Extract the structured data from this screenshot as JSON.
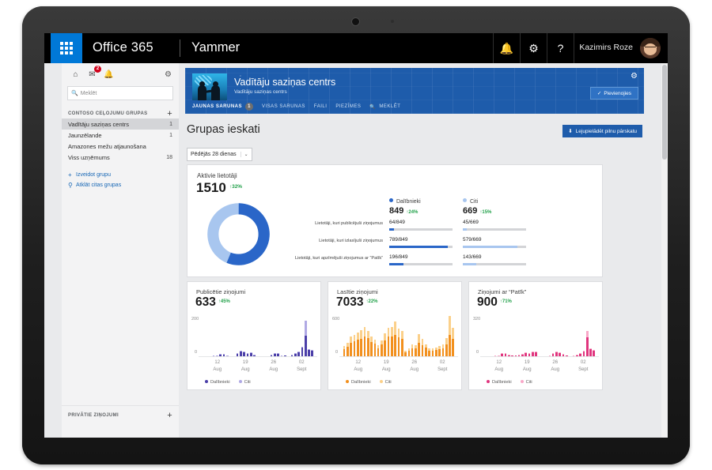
{
  "suite_bar": {
    "waffle_icon": "app-launcher-icon",
    "brand": "Office 365",
    "app": "Yammer",
    "bell_icon": "🔔",
    "gear_icon": "⚙",
    "help_icon": "?",
    "user_name": "Kazimirs Roze"
  },
  "sidebar": {
    "home_icon": "⌂",
    "inbox_icon": "✉",
    "bell_icon": "🔔",
    "inbox_badge": "2",
    "gear_icon": "⚙",
    "search_placeholder": "Meklēt",
    "search_value": "",
    "group_header": "CONTOSO CEļOJUMU GRUPAS",
    "add_icon": "+",
    "groups": [
      {
        "label": "Vadītāju saziņas centrs",
        "count": "1",
        "active": true
      },
      {
        "label": "Jaunzēlande",
        "count": "1",
        "active": false
      },
      {
        "label": "Amazones mežu atjaunošana",
        "count": "",
        "active": false
      },
      {
        "label": "Viss uzņēmums",
        "count": "18",
        "active": false
      }
    ],
    "links": [
      {
        "icon": "+",
        "label": "Izveidot grupu"
      },
      {
        "icon": "⚲",
        "label": "Atklāt citas grupas"
      }
    ],
    "private_messages": "PRIVĀTIE ZIŅOJUMI",
    "private_add_icon": "+"
  },
  "group_header": {
    "title": "Vadītāju saziņas centrs",
    "subtitle": "Vadītāju saziņas centrs",
    "gear_icon": "⚙",
    "join_label": "Pievienojies",
    "join_check": "✓",
    "tabs": [
      {
        "label": "JAUNAS SARUNAS",
        "badge": "1",
        "selected": true
      },
      {
        "label": "VISAS SARUNAS",
        "badge": "",
        "selected": false
      },
      {
        "label": "FAILI",
        "badge": "",
        "selected": false
      },
      {
        "label": "PIEZĪMES",
        "badge": "",
        "selected": false
      },
      {
        "label": "MEKLĒT",
        "badge": "",
        "selected": false,
        "icon": "🔍"
      }
    ]
  },
  "page": {
    "title": "Grupas ieskati",
    "download_label": "Lejupielādēt pilnu pārskatu",
    "download_icon": "⬇",
    "period_value": "Pēdējās 28 dienas",
    "period_chevron": "⌄"
  },
  "active_users": {
    "title": "Aktivie lietotāji",
    "value": "1510",
    "delta": "↑32%",
    "legend": [
      {
        "name": "Dalībnieki",
        "value": "849",
        "delta": "↑24%",
        "color": "#2a66c8"
      },
      {
        "name": "Citi",
        "value": "669",
        "delta": "↑15%",
        "color": "#a8c6ef"
      }
    ],
    "rows": [
      {
        "label": "Lietotāji, kuri publicējuši ziņojumus",
        "members": "64/849",
        "others": "45/669",
        "members_pct": 7.5,
        "others_pct": 6.7
      },
      {
        "label": "Lietotāji, kuri izlasījuši ziņojumus",
        "members": "789/849",
        "others": "579/669",
        "members_pct": 93,
        "others_pct": 86.5
      },
      {
        "label": "Lietotāji, kuri apzīmējuši ziņojumus ar “Patīk”",
        "members": "196/849",
        "others": "143/669",
        "members_pct": 23.1,
        "others_pct": 21.4
      }
    ]
  },
  "chart_data": [
    {
      "type": "bar",
      "title": "Publicētie ziņojumi",
      "total": "633",
      "delta": "↑45%",
      "ylabel": "",
      "xlabel": "",
      "ylim": [
        0,
        200
      ],
      "ytick_max": "200",
      "ytick_min": "0",
      "xtick_labels": [
        {
          "top": "12",
          "bottom": "Aug"
        },
        {
          "top": "19",
          "bottom": "Aug"
        },
        {
          "top": "26",
          "bottom": "Aug"
        },
        {
          "top": "02",
          "bottom": "Sept"
        }
      ],
      "legend": [
        {
          "name": "Dalībnieki",
          "color": "#4b3fa8"
        },
        {
          "name": "Citi",
          "color": "#b0a9e4"
        }
      ],
      "colors": {
        "members": "#4b3fa8",
        "others": "#b0a9e4"
      },
      "series": [
        {
          "name": "Dalībnieki",
          "values": [
            2,
            1,
            1,
            3,
            5,
            9,
            11,
            4,
            2,
            1,
            16,
            24,
            21,
            14,
            17,
            6,
            1,
            1,
            1,
            1,
            6,
            14,
            16,
            5,
            3,
            2,
            8,
            13,
            22,
            44,
            106,
            31,
            30
          ]
        },
        {
          "name": "Citi",
          "values": [
            0,
            0,
            0,
            1,
            1,
            2,
            2,
            1,
            0,
            0,
            2,
            3,
            2,
            2,
            2,
            1,
            0,
            0,
            0,
            0,
            1,
            2,
            2,
            1,
            0,
            0,
            1,
            2,
            3,
            6,
            75,
            4,
            3
          ]
        }
      ]
    },
    {
      "type": "bar",
      "title": "Lasītie ziņojumi",
      "total": "7033",
      "delta": "↑22%",
      "ylabel": "",
      "xlabel": "",
      "ylim": [
        0,
        600
      ],
      "ytick_max": "600",
      "ytick_min": "0",
      "xtick_labels": [
        {
          "top": "12",
          "bottom": "Aug"
        },
        {
          "top": "19",
          "bottom": "Aug"
        },
        {
          "top": "26",
          "bottom": "Aug"
        },
        {
          "top": "02",
          "bottom": "Sept"
        }
      ],
      "legend": [
        {
          "name": "Dalībnieki",
          "color": "#f2901e"
        },
        {
          "name": "Citi",
          "color": "#fbd08a"
        }
      ],
      "colors": {
        "members": "#f2901e",
        "others": "#fbd08a"
      },
      "series": [
        {
          "name": "Dalībnieki",
          "values": [
            110,
            150,
            210,
            230,
            250,
            265,
            300,
            280,
            215,
            190,
            125,
            175,
            245,
            300,
            295,
            330,
            290,
            270,
            60,
            90,
            125,
            115,
            210,
            170,
            130,
            90,
            85,
            95,
            110,
            120,
            185,
            320,
            265
          ]
        },
        {
          "name": "Citi",
          "values": [
            45,
            60,
            90,
            100,
            115,
            130,
            140,
            110,
            80,
            60,
            45,
            70,
            100,
            130,
            150,
            200,
            130,
            110,
            20,
            30,
            55,
            50,
            130,
            90,
            55,
            35,
            35,
            40,
            45,
            60,
            95,
            290,
            165
          ]
        }
      ]
    },
    {
      "type": "bar",
      "title": "Ziņojumi ar “Patīk”",
      "total": "900",
      "delta": "↑71%",
      "ylabel": "",
      "xlabel": "",
      "ylim": [
        0,
        320
      ],
      "ytick_max": "320",
      "ytick_min": "0",
      "xtick_labels": [
        {
          "top": "12",
          "bottom": "Aug"
        },
        {
          "top": "19",
          "bottom": "Aug"
        },
        {
          "top": "26",
          "bottom": "Aug"
        },
        {
          "top": "02",
          "bottom": "Sept"
        }
      ],
      "legend": [
        {
          "name": "Dalībnieki",
          "color": "#e0357e"
        },
        {
          "name": "Citi",
          "color": "#f9a8c8"
        }
      ],
      "colors": {
        "members": "#e0357e",
        "others": "#f9a8c8"
      },
      "series": [
        {
          "name": "Dalībnieki",
          "values": [
            2,
            1,
            2,
            5,
            8,
            22,
            25,
            10,
            6,
            4,
            10,
            20,
            28,
            22,
            34,
            30,
            2,
            1,
            1,
            6,
            22,
            34,
            26,
            16,
            4,
            2,
            8,
            14,
            22,
            42,
            152,
            56,
            44
          ]
        },
        {
          "name": "Citi",
          "values": [
            0,
            0,
            0,
            1,
            1,
            3,
            3,
            1,
            0,
            0,
            1,
            2,
            3,
            2,
            4,
            9,
            0,
            0,
            0,
            1,
            2,
            4,
            3,
            2,
            0,
            0,
            1,
            2,
            3,
            5,
            52,
            6,
            5
          ]
        }
      ]
    }
  ]
}
